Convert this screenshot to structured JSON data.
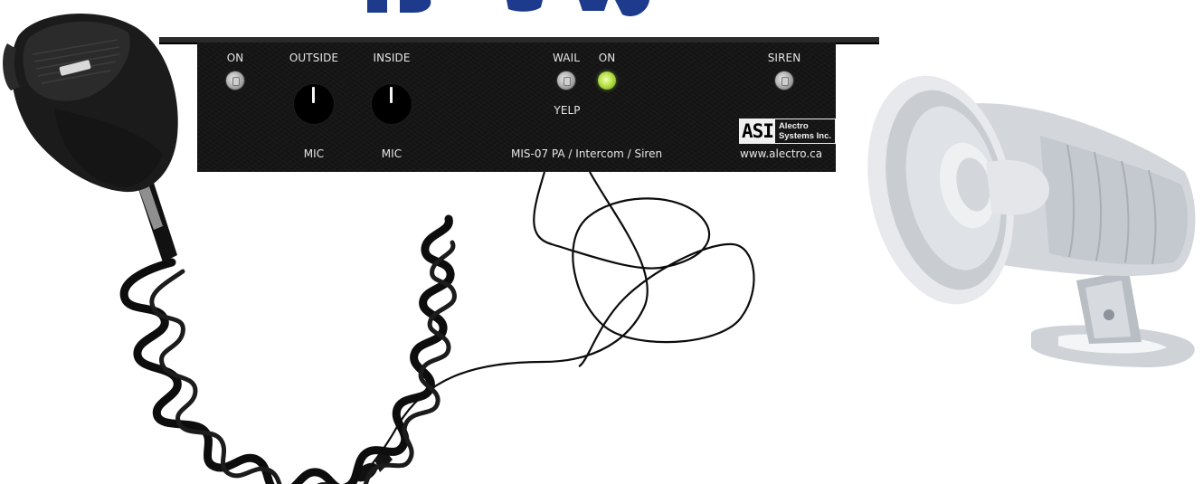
{
  "panel": {
    "labels": {
      "on_left": "ON",
      "outside": "OUTSIDE",
      "inside": "INSIDE",
      "wail": "WAIL",
      "on_right": "ON",
      "siren": "SIREN",
      "yelp": "YELP",
      "mic_outside": "MIC",
      "mic_inside": "MIC"
    },
    "model_text": "MIS-07 PA / Intercom / Siren",
    "logo_mark": "ASI",
    "logo_line1": "Alectro",
    "logo_line2": "Systems Inc.",
    "url": "www.alectro.ca",
    "led_status": "on"
  },
  "icons": {
    "microphone": "handheld-microphone-icon",
    "horn": "horn-speaker-icon",
    "cable": "coiled-cable-icon"
  },
  "colors": {
    "panel": "#141414",
    "led": "#b6e24a",
    "label": "#e6e6e6",
    "title": "#1e3a8a"
  }
}
